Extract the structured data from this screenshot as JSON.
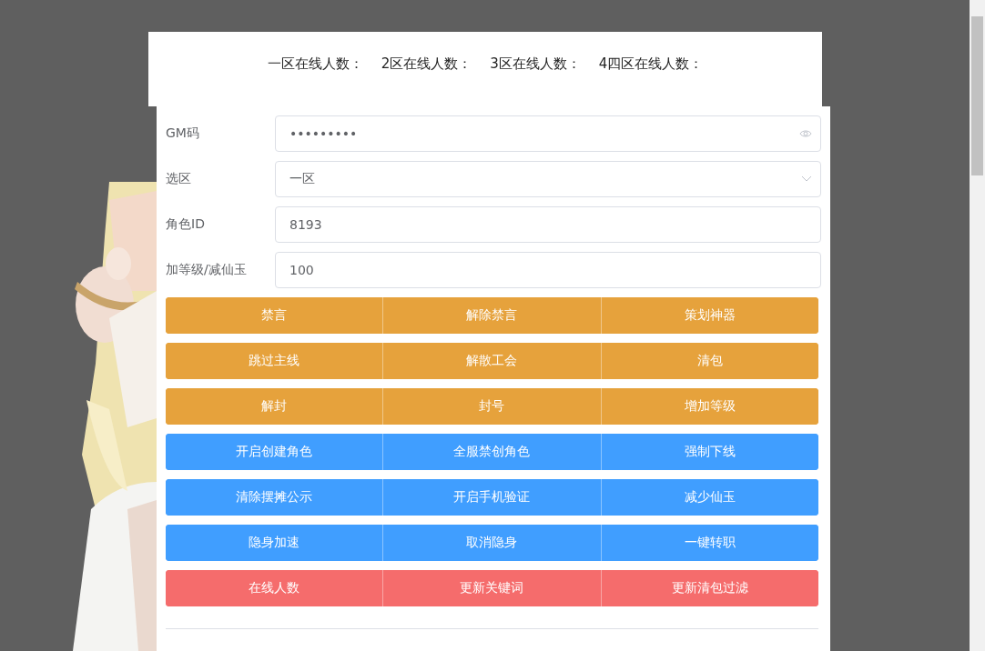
{
  "online_counts": [
    "一区在线人数：",
    "2区在线人数：",
    "3区在线人数：",
    "4四区在线人数："
  ],
  "fields": [
    {
      "kind": "password",
      "label": "GM码",
      "value": "•••••••••"
    },
    {
      "kind": "select",
      "label": "选区",
      "value": "一区"
    },
    {
      "kind": "text",
      "label": "角色ID",
      "value": "8193"
    },
    {
      "kind": "text",
      "label": "加等级/减仙玉",
      "value": "100"
    }
  ],
  "button_rows": [
    {
      "kind": "warning",
      "buttons": [
        "禁言",
        "解除禁言",
        "策划神器"
      ]
    },
    {
      "kind": "warning",
      "buttons": [
        "跳过主线",
        "解散工会",
        "清包"
      ]
    },
    {
      "kind": "warning",
      "buttons": [
        "解封",
        "封号",
        "增加等级"
      ]
    },
    {
      "kind": "primary",
      "buttons": [
        "开启创建角色",
        "全服禁创角色",
        "强制下线"
      ]
    },
    {
      "kind": "primary",
      "buttons": [
        "清除摆摊公示",
        "开启手机验证",
        "减少仙玉"
      ]
    },
    {
      "kind": "primary",
      "buttons": [
        "隐身加速",
        "取消隐身",
        "一键转职"
      ]
    },
    {
      "kind": "danger",
      "buttons": [
        "在线人数",
        "更新关键词",
        "更新清包过滤"
      ]
    }
  ]
}
